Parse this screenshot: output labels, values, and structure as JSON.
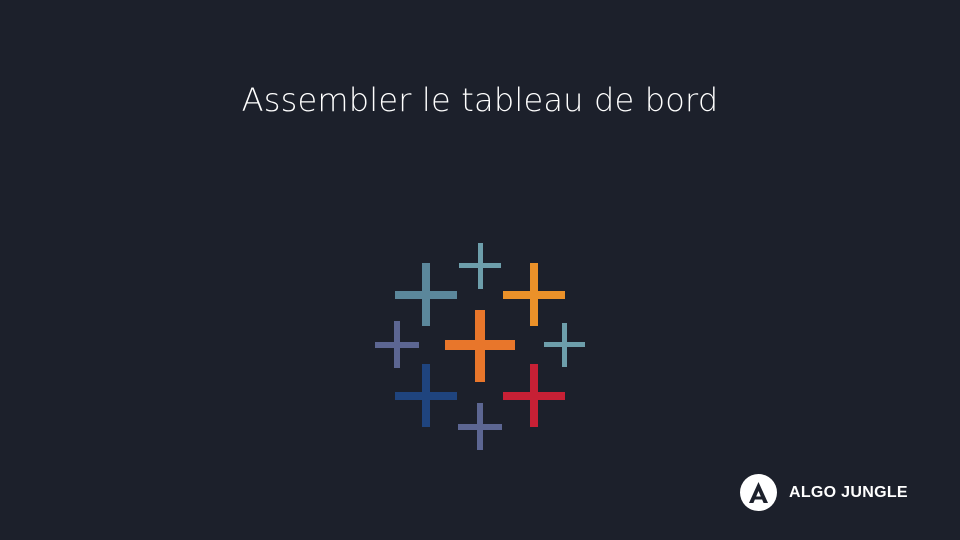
{
  "slide": {
    "title": "Assembler le tableau de bord"
  },
  "logo": {
    "icon": "tableau-logo-icon",
    "colors": {
      "teal": "#5b879b",
      "light_teal": "#6d9eab",
      "orange": "#e8762b",
      "amber": "#eb9129",
      "purple": "#5c6692",
      "navy": "#1f447e",
      "red": "#c72035"
    }
  },
  "brand": {
    "icon": "algo-jungle-icon",
    "name": "ALGO JUNGLE"
  },
  "colors": {
    "background": "#1c202b",
    "text": "#ffffff"
  }
}
